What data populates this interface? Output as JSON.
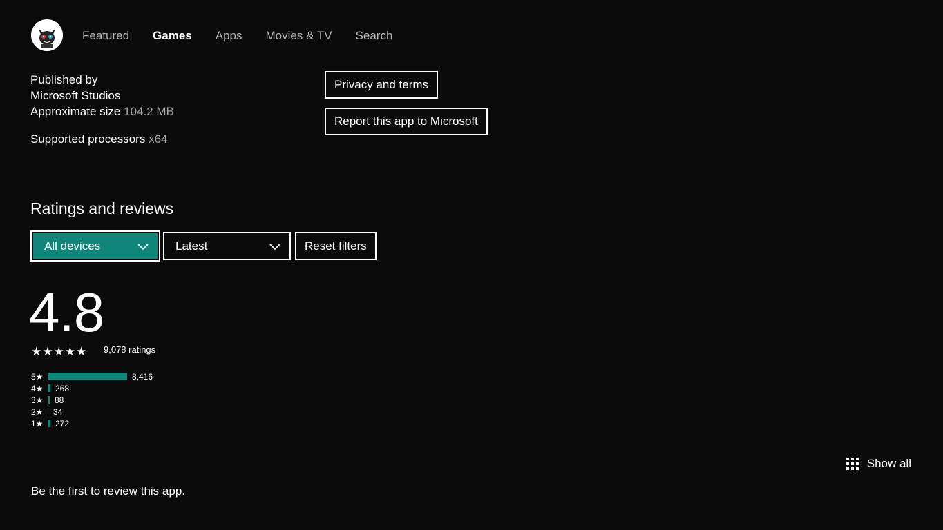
{
  "nav": {
    "items": [
      {
        "label": "Featured",
        "active": false
      },
      {
        "label": "Games",
        "active": true
      },
      {
        "label": "Apps",
        "active": false
      },
      {
        "label": "Movies & TV",
        "active": false
      },
      {
        "label": "Search",
        "active": false
      }
    ]
  },
  "info": {
    "published_by_label": "Published by",
    "publisher": "Microsoft Studios",
    "size_label": "Approximate size",
    "size_value": "104.2 MB",
    "processors_label": "Supported processors",
    "processors_value": "x64"
  },
  "buttons": {
    "privacy": "Privacy and terms",
    "report": "Report this app to Microsoft"
  },
  "ratings": {
    "title": "Ratings and reviews",
    "device_filter": "All devices",
    "sort_filter": "Latest",
    "reset_label": "Reset filters",
    "average": "4.8",
    "stars": "★★★★★",
    "count_label": "9,078 ratings",
    "histogram": [
      {
        "label": "5★",
        "count": "8,416",
        "value": 8416
      },
      {
        "label": "4★",
        "count": "268",
        "value": 268
      },
      {
        "label": "3★",
        "count": "88",
        "value": 88
      },
      {
        "label": "2★",
        "count": "34",
        "value": 34
      },
      {
        "label": "1★",
        "count": "272",
        "value": 272
      }
    ]
  },
  "show_all_label": "Show all",
  "first_review_text": "Be the first to review this app.",
  "colors": {
    "background": "#0b0b0b",
    "accent": "#10857a",
    "muted_text": "#a8a8a8"
  }
}
